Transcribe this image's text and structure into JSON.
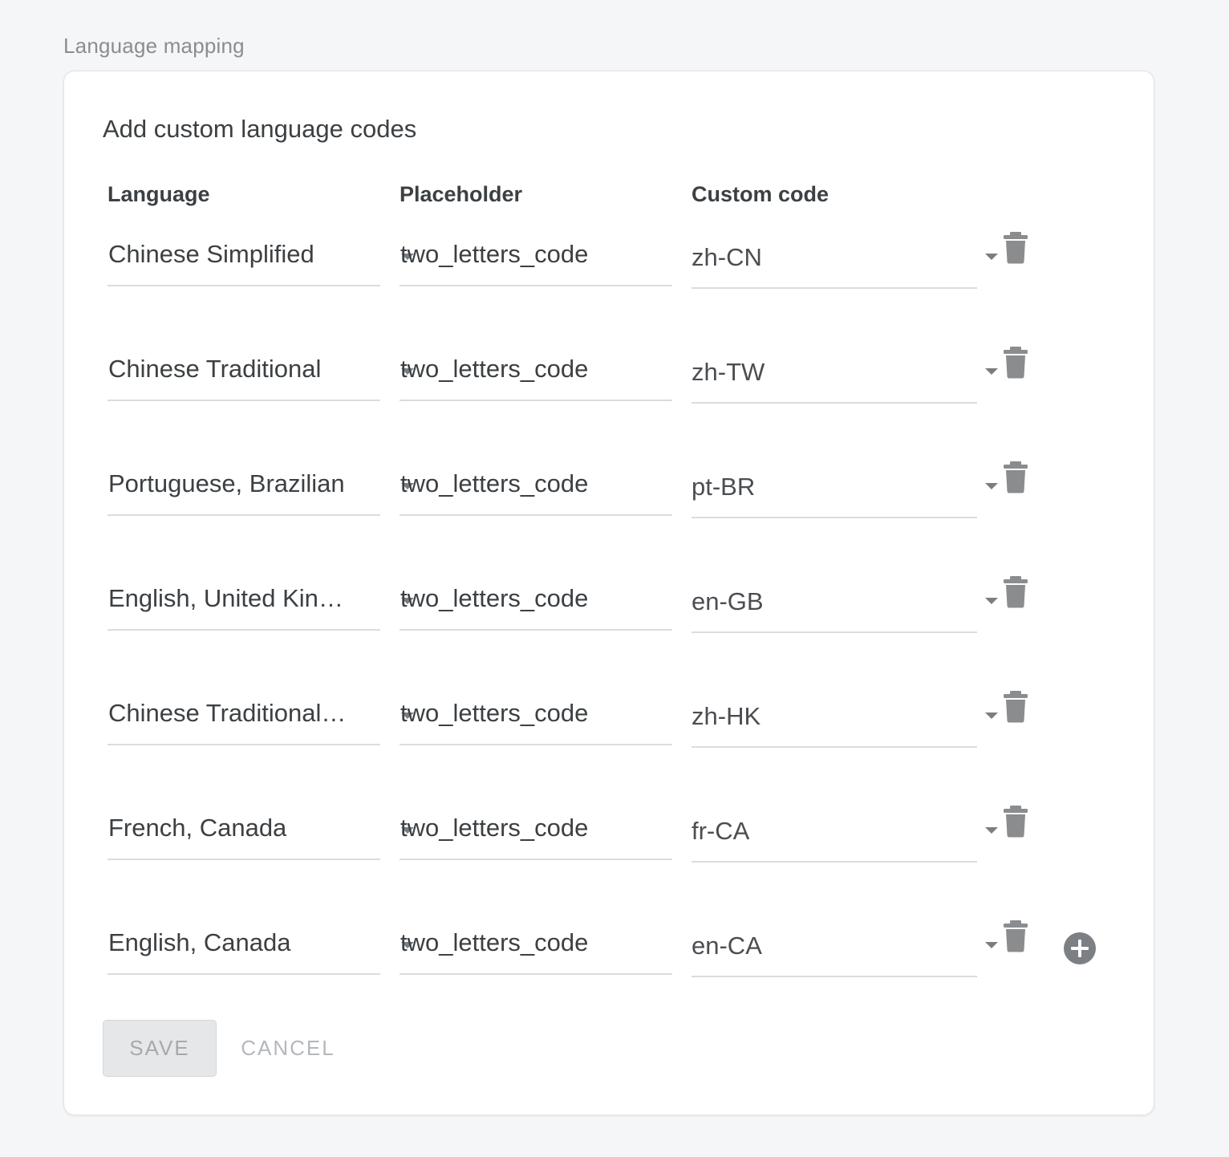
{
  "section_label": "Language mapping",
  "card": {
    "title": "Add custom language codes",
    "columns": {
      "language": "Language",
      "placeholder": "Placeholder",
      "custom_code": "Custom code"
    },
    "rows": [
      {
        "language": "Chinese Simplified",
        "placeholder": "two_letters_code",
        "code": "zh-CN"
      },
      {
        "language": "Chinese Traditional",
        "placeholder": "two_letters_code",
        "code": "zh-TW"
      },
      {
        "language": "Portuguese, Brazilian",
        "placeholder": "two_letters_code",
        "code": "pt-BR"
      },
      {
        "language": "English, United Kingdom",
        "placeholder": "two_letters_code",
        "code": "en-GB"
      },
      {
        "language": "Chinese Traditional, Hong Kong",
        "placeholder": "two_letters_code",
        "code": "zh-HK"
      },
      {
        "language": "French, Canada",
        "placeholder": "two_letters_code",
        "code": "fr-CA"
      },
      {
        "language": "English, Canada",
        "placeholder": "two_letters_code",
        "code": "en-CA"
      }
    ],
    "icons": {
      "delete": "trash-icon",
      "add": "plus-circle-icon",
      "dropdown": "caret-down-icon"
    },
    "actions": {
      "save": "SAVE",
      "cancel": "CANCEL"
    }
  },
  "colors": {
    "icon_gray": "#8a8c8e",
    "text": "#3c4043",
    "background": "#f5f6f8"
  }
}
